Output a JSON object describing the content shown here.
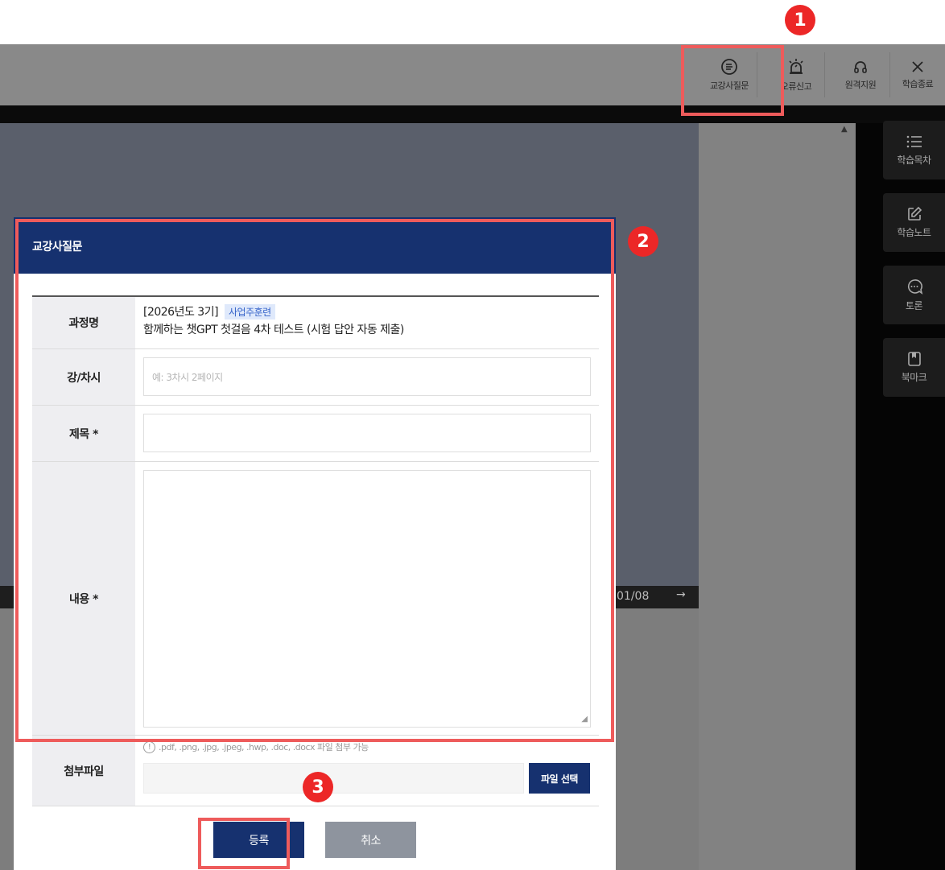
{
  "toolbar": {
    "items": [
      {
        "label": "교강사질문",
        "icon": "chat-list-icon"
      },
      {
        "label": "오류신고",
        "icon": "siren-icon"
      },
      {
        "label": "원격지원",
        "icon": "headset-icon"
      },
      {
        "label": "학습종료",
        "icon": "close-icon"
      }
    ]
  },
  "sidebar": {
    "items": [
      {
        "label": "학습목차",
        "icon": "list-icon"
      },
      {
        "label": "학습노트",
        "icon": "edit-icon"
      },
      {
        "label": "토론",
        "icon": "chat-bubble-icon"
      },
      {
        "label": "북마크",
        "icon": "bookmark-icon"
      }
    ]
  },
  "player": {
    "page_counter": "01/08",
    "next_arrow": "→"
  },
  "modal": {
    "title": "교강사질문",
    "course": {
      "label": "과정명",
      "term": "[2026년도 3기]",
      "badge": "사업주훈련",
      "name": "함께하는 챗GPT 첫걸음 4차 테스트 (시험 답안 자동 제출)"
    },
    "lecture": {
      "label": "강/차시",
      "placeholder": "예: 3차시 2페이지",
      "value": ""
    },
    "subject": {
      "label": "제목 *",
      "value": ""
    },
    "content": {
      "label": "내용 *",
      "value": ""
    },
    "attachment": {
      "label": "첨부파일",
      "note": ".pdf, .png, .jpg, .jpeg, .hwp, .doc, .docx 파일 첨부 가능",
      "select_label": "파일 선택"
    },
    "actions": {
      "submit": "등록",
      "cancel": "취소"
    }
  },
  "annotations": {
    "markers": [
      "1",
      "2",
      "3"
    ],
    "highlight_color": "#ee5b5b",
    "marker_color": "#ec2727"
  },
  "colors": {
    "header_navy": "#16316f",
    "cancel_gray": "#8e949e",
    "badge_bg": "#dfe9fb",
    "badge_text": "#3563c9"
  }
}
